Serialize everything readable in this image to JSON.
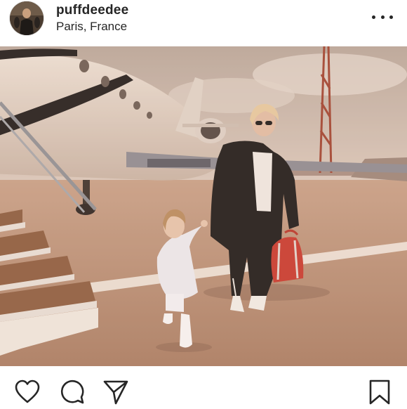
{
  "post": {
    "username": "puffdeedee",
    "location": "Paris, France"
  },
  "icons": {
    "avatar": "profile-avatar",
    "more": "more-options-icon",
    "like": "heart-icon",
    "comment": "comment-bubble-icon",
    "share": "paper-plane-icon",
    "save": "bookmark-icon"
  },
  "colors": {
    "text": "#262626",
    "photo_tint": "#d9b99f",
    "bag": "#c8372d"
  }
}
